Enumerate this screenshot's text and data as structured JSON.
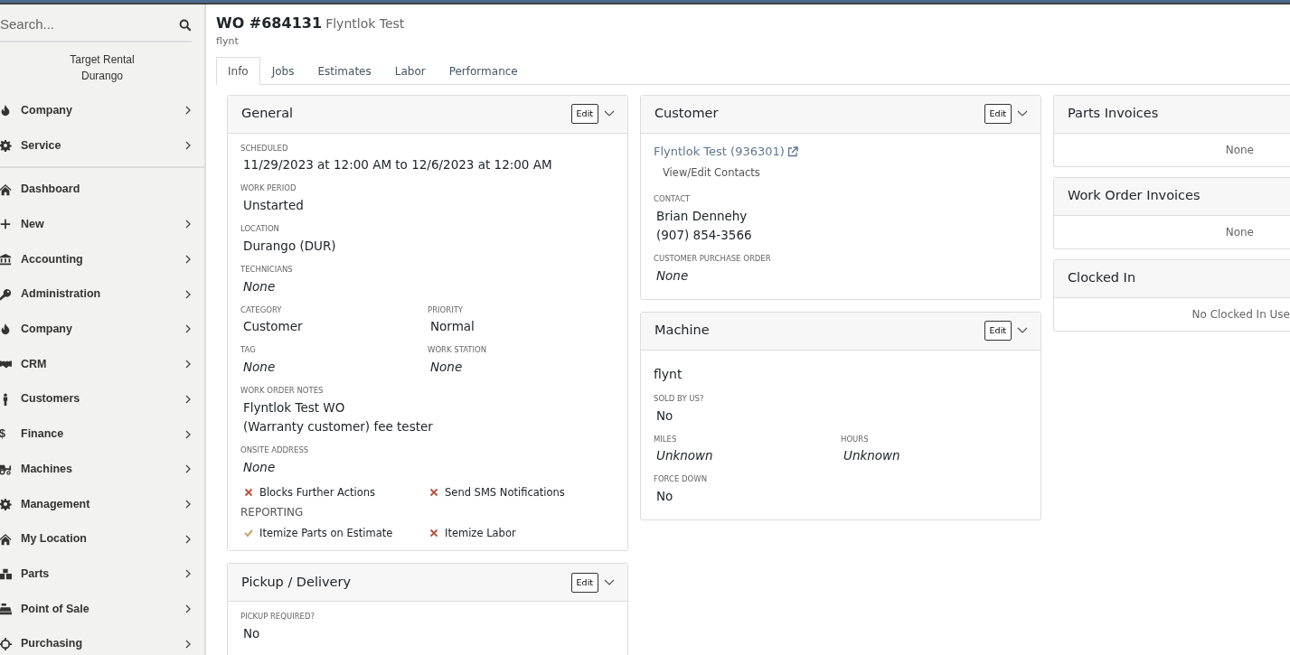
{
  "sidebar": {
    "search": {
      "placeholder": "Search..."
    },
    "location": [
      "Target Rental",
      "Durango"
    ],
    "groups": [
      {
        "items": [
          {
            "label": "Company",
            "expandable": true
          },
          {
            "label": "Service",
            "expandable": true
          }
        ]
      },
      {
        "items": [
          {
            "label": "Dashboard",
            "expandable": false
          },
          {
            "label": "New",
            "expandable": true
          },
          {
            "label": "Accounting",
            "expandable": true
          },
          {
            "label": "Administration",
            "expandable": true
          },
          {
            "label": "Company",
            "expandable": true
          },
          {
            "label": "CRM",
            "expandable": true
          },
          {
            "label": "Customers",
            "expandable": true
          },
          {
            "label": "Finance",
            "expandable": true,
            "glyph": "$"
          },
          {
            "label": "Machines",
            "expandable": true
          },
          {
            "label": "Management",
            "expandable": true
          },
          {
            "label": "My Location",
            "expandable": true
          },
          {
            "label": "Parts",
            "expandable": true
          },
          {
            "label": "Point of Sale",
            "expandable": true
          },
          {
            "label": "Purchasing",
            "expandable": true
          }
        ]
      }
    ]
  },
  "header": {
    "number": "WO #684131",
    "name": "Flyntlok Test",
    "machine": "flynt"
  },
  "tabs": [
    {
      "label": "Info",
      "selected": true
    },
    {
      "label": "Jobs",
      "selected": false
    },
    {
      "label": "Estimates",
      "selected": false
    },
    {
      "label": "Labor",
      "selected": false
    },
    {
      "label": "Performance",
      "selected": false
    }
  ],
  "columns": [
    [
      {
        "title": "General",
        "edit": "Edit",
        "body": [
          {
            "kind": "field",
            "label": "SCHEDULED",
            "lines": [
              "11/29/2023 at 12:00 AM to 12/6/2023 at 12:00 AM"
            ],
            "italic": false
          },
          {
            "kind": "field",
            "label": "WORK PERIOD",
            "lines": [
              "Unstarted"
            ],
            "italic": false
          },
          {
            "kind": "field",
            "label": "LOCATION",
            "lines": [
              "Durango (DUR)"
            ],
            "italic": false
          },
          {
            "kind": "field",
            "label": "TECHNICIANS",
            "lines": [
              "None"
            ],
            "italic": true
          },
          {
            "kind": "pair",
            "fields": [
              {
                "label": "CATEGORY",
                "lines": [
                  "Customer"
                ],
                "italic": false
              },
              {
                "label": "PRIORITY",
                "lines": [
                  "Normal"
                ],
                "italic": false
              }
            ]
          },
          {
            "kind": "pair",
            "fields": [
              {
                "label": "TAG",
                "lines": [
                  "None"
                ],
                "italic": true
              },
              {
                "label": "WORK STATION",
                "lines": [
                  "None"
                ],
                "italic": true
              }
            ]
          },
          {
            "kind": "field",
            "label": "WORK ORDER NOTES",
            "lines": [
              "Flyntlok Test WO",
              "(Warranty customer) fee tester"
            ],
            "italic": false
          },
          {
            "kind": "field",
            "label": "ONSITE ADDRESS",
            "lines": [
              "None"
            ],
            "italic": true
          },
          {
            "kind": "flags",
            "items": [
              {
                "label": "Blocks Further Actions",
                "checked": false
              },
              {
                "label": "Send SMS Notifications",
                "checked": false
              }
            ]
          },
          {
            "kind": "heading",
            "text": "REPORTING"
          },
          {
            "kind": "flags",
            "items": [
              {
                "label": "Itemize Parts on Estimate",
                "checked": true
              },
              {
                "label": "Itemize Labor",
                "checked": false
              }
            ]
          }
        ]
      },
      {
        "title": "Pickup / Delivery",
        "edit": "Edit",
        "body": [
          {
            "kind": "field",
            "label": "PICKUP REQUIRED?",
            "lines": [
              "No"
            ],
            "italic": false
          }
        ]
      }
    ],
    [
      {
        "title": "Customer",
        "edit": "Edit",
        "body": [
          {
            "kind": "link",
            "text": "Flyntlok Test (936301)",
            "sub": "View/Edit Contacts"
          },
          {
            "kind": "field",
            "label": "CONTACT",
            "lines": [
              "Brian Dennehy",
              "(907) 854-3566"
            ],
            "italic": false
          },
          {
            "kind": "field",
            "label": "CUSTOMER PURCHASE ORDER",
            "lines": [
              "None"
            ],
            "italic": true
          }
        ]
      },
      {
        "title": "Machine",
        "edit": "Edit",
        "body": [
          {
            "kind": "text",
            "text": "flynt"
          },
          {
            "kind": "field",
            "label": "SOLD BY US?",
            "lines": [
              "No"
            ],
            "italic": false
          },
          {
            "kind": "pair",
            "fields": [
              {
                "label": "MILES",
                "lines": [
                  "Unknown"
                ],
                "italic": true
              },
              {
                "label": "HOURS",
                "lines": [
                  "Unknown"
                ],
                "italic": true
              }
            ]
          },
          {
            "kind": "field",
            "label": "FORCE DOWN",
            "lines": [
              "No"
            ],
            "italic": false
          }
        ]
      }
    ],
    [
      {
        "title": "Parts Invoices",
        "body": [
          {
            "kind": "empty",
            "text": "None"
          }
        ]
      },
      {
        "title": "Work Order Invoices",
        "body": [
          {
            "kind": "empty",
            "text": "None"
          }
        ]
      },
      {
        "title": "Clocked In",
        "body": [
          {
            "kind": "empty",
            "text": "No Clocked In Use"
          }
        ]
      }
    ]
  ]
}
